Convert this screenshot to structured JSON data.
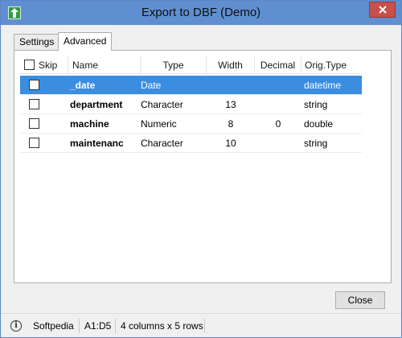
{
  "window": {
    "title": "Export to DBF (Demo)"
  },
  "tabs": [
    {
      "label": "Settings",
      "active": false
    },
    {
      "label": "Advanced",
      "active": true
    }
  ],
  "grid": {
    "headers": {
      "skip": "Skip",
      "name": "Name",
      "type": "Type",
      "width": "Width",
      "decimal": "Decimal",
      "orig_type": "Orig.Type"
    },
    "rows": [
      {
        "skip": false,
        "name": "_date",
        "type": "Date",
        "width": "",
        "decimal": "",
        "orig_type": "datetime",
        "selected": true
      },
      {
        "skip": false,
        "name": "department",
        "type": "Character",
        "width": "13",
        "decimal": "",
        "orig_type": "string",
        "selected": false
      },
      {
        "skip": false,
        "name": "machine",
        "type": "Numeric",
        "width": "8",
        "decimal": "0",
        "orig_type": "double",
        "selected": false
      },
      {
        "skip": false,
        "name": "maintenanc",
        "type": "Character",
        "width": "10",
        "decimal": "",
        "orig_type": "string",
        "selected": false
      }
    ]
  },
  "buttons": {
    "close": "Close"
  },
  "status": {
    "app": "Softpedia",
    "range": "A1:D5",
    "summary": "4 columns x 5 rows"
  },
  "colors": {
    "titlebar": "#5f8fd0",
    "selection": "#3b8de0"
  }
}
